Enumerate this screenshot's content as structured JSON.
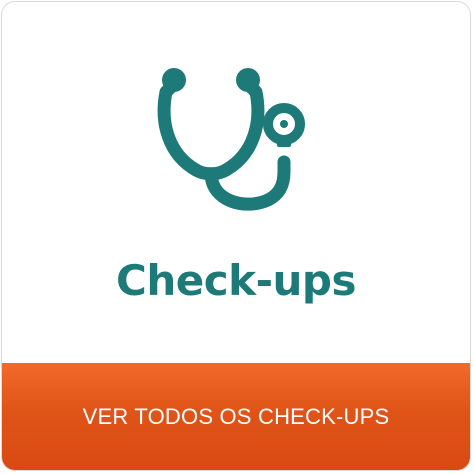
{
  "card": {
    "title": "Check-ups",
    "icon": "stethoscope-icon",
    "cta_label": "VER TODOS OS CHECK-UPS"
  },
  "colors": {
    "primary": "#1d7a78",
    "cta_background": "#e05418",
    "cta_text": "#ffffff"
  }
}
